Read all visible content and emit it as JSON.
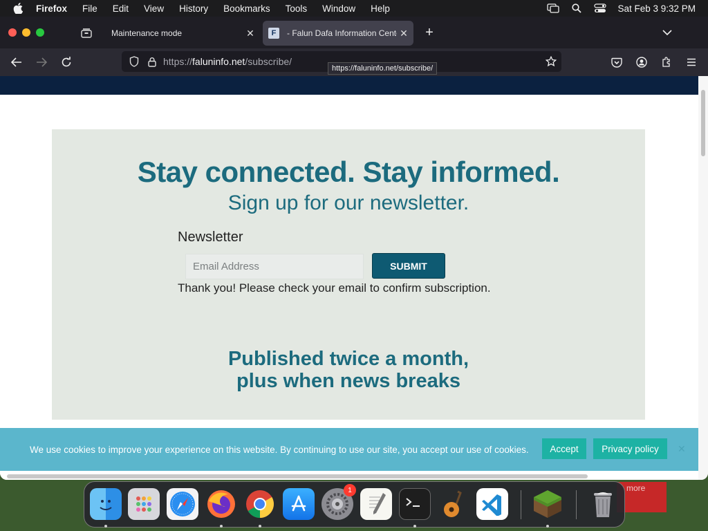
{
  "menubar": {
    "app_name": "Firefox",
    "items": [
      "File",
      "Edit",
      "View",
      "History",
      "Bookmarks",
      "Tools",
      "Window",
      "Help"
    ],
    "clock": "Sat Feb 3  9:32 PM"
  },
  "browser": {
    "tabs": [
      {
        "title": "Maintenance mode",
        "active": false
      },
      {
        "title": "- Falun Dafa Information Cente",
        "favicon": "F",
        "active": true
      }
    ],
    "tooltip": "https://faluninfo.net/subscribe/",
    "url": {
      "scheme": "https://",
      "host": "faluninfo.net",
      "path": "/subscribe/"
    }
  },
  "page": {
    "headline": "Stay connected. Stay informed.",
    "subhead": "Sign up for our newsletter.",
    "newsletter_label": "Newsletter",
    "email_placeholder": "Email Address",
    "submit_label": "SUBMIT",
    "confirmation": "Thank you! Please check your email to confirm subscription.",
    "published_line1": "Published twice a month,",
    "published_line2": "plus when news breaks"
  },
  "cookie_banner": {
    "text": "We use cookies to improve your experience on this website. By continuing to use our site, you accept our use of cookies.",
    "accept_label": "Accept",
    "privacy_label": "Privacy policy"
  },
  "desktop": {
    "widget_text": "more"
  },
  "dock": {
    "apps": [
      "finder-icon",
      "launchpad-icon",
      "safari-icon",
      "firefox-icon",
      "chrome-icon",
      "app-store-icon",
      "system-settings-icon",
      "textedit-icon",
      "terminal-icon",
      "garageband-icon",
      "vscode-icon",
      "minecraft-icon",
      "trash-icon"
    ],
    "settings_badge": "1"
  },
  "colors": {
    "brand_teal": "#1c6b7e",
    "submit_bg": "#0e5a72",
    "cookie_bg": "#5bb6cc",
    "cookie_btn": "#1db2a4",
    "site_header": "#0b2140"
  }
}
